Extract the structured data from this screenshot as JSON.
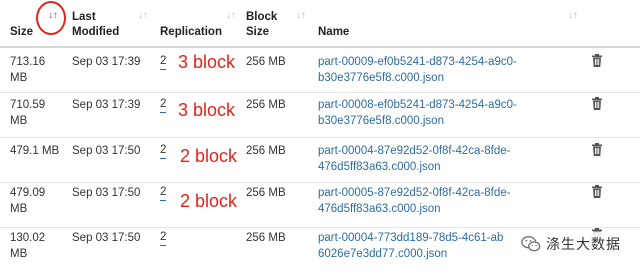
{
  "header": {
    "size": "Size",
    "last_modified_line1": "Last",
    "last_modified_line2": "Modified",
    "replication": "Replication",
    "block_size_line1": "Block",
    "block_size_line2": "Size",
    "name": "Name",
    "sort_icon": "↓↑"
  },
  "rows": [
    {
      "size_line1": "713.16",
      "size_line2": "MB",
      "modified": "Sep 03 17:39",
      "replication": "2",
      "annotation": "3 block",
      "block_size": "256 MB",
      "name_line1": "part-00009-ef0b5241-d873-4254-a9c0-",
      "name_line2": "b30e3776e5f8.c000.json"
    },
    {
      "size_line1": "710.59",
      "size_line2": "MB",
      "modified": "Sep 03 17:39",
      "replication": "2",
      "annotation": "3 block",
      "block_size": "256 MB",
      "name_line1": "part-00008-ef0b5241-d873-4254-a9c0-",
      "name_line2": "b30e3776e5f8.c000.json"
    },
    {
      "size_line1": "479.1 MB",
      "size_line2": "",
      "modified": "Sep 03 17:50",
      "replication": "2",
      "annotation": "2 block",
      "block_size": "256 MB",
      "name_line1": "part-00004-87e92d52-0f8f-42ca-8fde-",
      "name_line2": "476d5ff83a63.c000.json"
    },
    {
      "size_line1": "479.09",
      "size_line2": "MB",
      "modified": "Sep 03 17:50",
      "replication": "2",
      "annotation": "2 block",
      "block_size": "256 MB",
      "name_line1": "part-00005-87e92d52-0f8f-42ca-8fde-",
      "name_line2": "476d5ff83a63.c000.json"
    },
    {
      "size_line1": "130.02",
      "size_line2": "MB",
      "modified": "Sep 03 17:50",
      "replication": "2",
      "annotation": "",
      "block_size": "256 MB",
      "name_line1": "part-00004-773dd189-78d5-4c61-ab",
      "name_line2": "6026e7e3dd77.c000.json"
    }
  ],
  "icons": {
    "delete": "trash-icon",
    "sort": "sort-arrows-icon",
    "watermark": "wechat-icon"
  },
  "watermark": {
    "text": "涤生大数据"
  },
  "colors": {
    "link": "#2d6ca2",
    "annotation": "#e2231a",
    "sort_inactive": "#bbbbbb"
  }
}
